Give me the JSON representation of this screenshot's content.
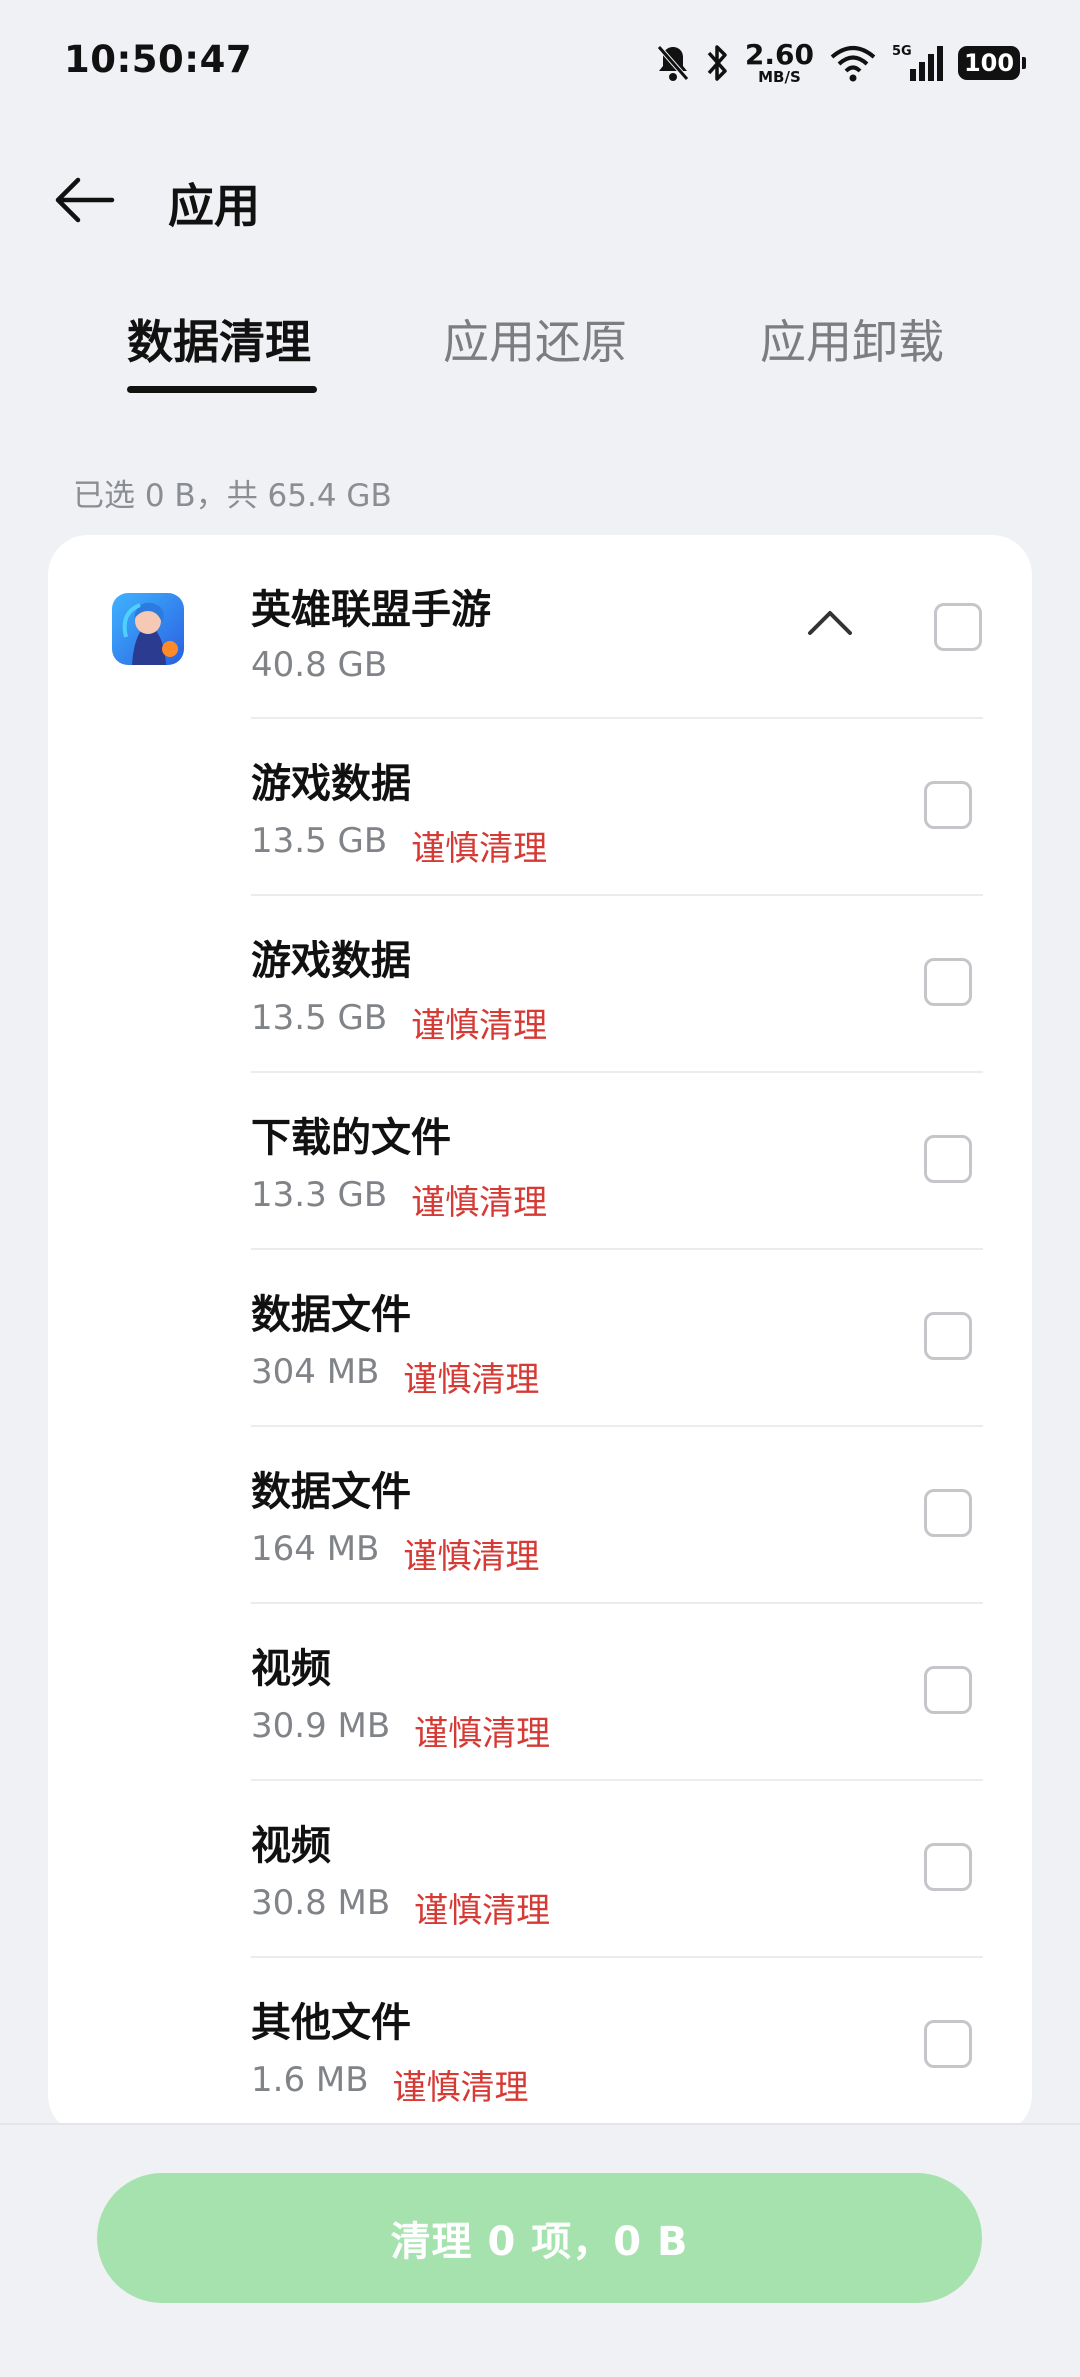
{
  "status": {
    "time": "10:50:47",
    "net_speed": "2.60",
    "net_unit": "MB/S",
    "signal_label": "5G",
    "battery": "100"
  },
  "header": {
    "title": "应用"
  },
  "tabs": [
    {
      "label": "数据清理",
      "active": true
    },
    {
      "label": "应用还原",
      "active": false
    },
    {
      "label": "应用卸载",
      "active": false
    }
  ],
  "summary": "已选 0 B，共 65.4 GB",
  "app": {
    "name": "英雄联盟手游",
    "size": "40.8 GB",
    "icon": "game-icon"
  },
  "items": [
    {
      "label": "游戏数据",
      "size": "13.5 GB",
      "warning": "谨慎清理"
    },
    {
      "label": "游戏数据",
      "size": "13.5 GB",
      "warning": "谨慎清理"
    },
    {
      "label": "下载的文件",
      "size": "13.3 GB",
      "warning": "谨慎清理"
    },
    {
      "label": "数据文件",
      "size": "304 MB",
      "warning": "谨慎清理"
    },
    {
      "label": "数据文件",
      "size": "164 MB",
      "warning": "谨慎清理"
    },
    {
      "label": "视频",
      "size": "30.9 MB",
      "warning": "谨慎清理"
    },
    {
      "label": "视频",
      "size": "30.8 MB",
      "warning": "谨慎清理"
    },
    {
      "label": "其他文件",
      "size": "1.6 MB",
      "warning": "谨慎清理"
    }
  ],
  "bottom": {
    "clean_label": "清理 0 项，0 B"
  },
  "colors": {
    "accent": "#a6e2ae",
    "warning": "#d63a35",
    "background": "#f0f1f4"
  }
}
